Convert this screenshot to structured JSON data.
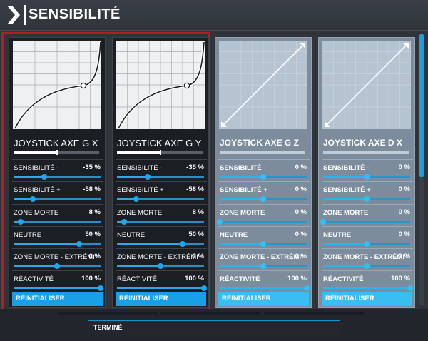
{
  "header": {
    "title": "SENSIBILITÉ"
  },
  "cards": [
    {
      "title": "JOYSTICK AXE G X",
      "top_bar_level": 0.5,
      "graph": "curve",
      "rows": [
        {
          "label": "SENSIBILITÉ -",
          "value": "-35 %",
          "level": 0.35
        },
        {
          "label": "SENSIBILITÉ +",
          "value": "-58 %",
          "level": 0.22
        },
        {
          "label": "ZONE MORTE",
          "value": "8 %",
          "level": 0.08
        },
        {
          "label": "NEUTRE",
          "value": "50 %",
          "level": 0.75
        },
        {
          "label": "ZONE MORTE - EXTRÉMI",
          "value": "0 %",
          "level": 0.5
        },
        {
          "label": "RÉACTIVITÉ",
          "value": "100 %",
          "level": 1.0
        }
      ],
      "reset_label": "RÉINITIALISER"
    },
    {
      "title": "JOYSTICK AXE G Y",
      "top_bar_level": 0.5,
      "graph": "curve",
      "rows": [
        {
          "label": "SENSIBILITÉ -",
          "value": "-35 %",
          "level": 0.35
        },
        {
          "label": "SENSIBILITÉ +",
          "value": "-58 %",
          "level": 0.22
        },
        {
          "label": "ZONE MORTE",
          "value": "8 %",
          "level": 0.08
        },
        {
          "label": "NEUTRE",
          "value": "50 %",
          "level": 0.75
        },
        {
          "label": "ZONE MORTE - EXTRÉMI",
          "value": "0 %",
          "level": 0.5
        },
        {
          "label": "RÉACTIVITÉ",
          "value": "100 %",
          "level": 1.0
        }
      ],
      "reset_label": "RÉINITIALISER"
    },
    {
      "title": "JOYSTICK AXE G Z",
      "top_bar_level": 0.0,
      "graph": "linear",
      "rows": [
        {
          "label": "SENSIBILITÉ -",
          "value": "0 %",
          "level": 0.5
        },
        {
          "label": "SENSIBILITÉ +",
          "value": "0 %",
          "level": 0.5
        },
        {
          "label": "ZONE MORTE",
          "value": "0 %",
          "level": 0.0
        },
        {
          "label": "NEUTRE",
          "value": "0 %",
          "level": 0.5
        },
        {
          "label": "ZONE MORTE - EXTRÉMI",
          "value": "0 %",
          "level": 0.5
        },
        {
          "label": "RÉACTIVITÉ",
          "value": "100 %",
          "level": 1.0
        }
      ],
      "reset_label": "RÉINITIALISER"
    },
    {
      "title": "JOYSTICK AXE D X",
      "top_bar_level": 0.0,
      "graph": "linear",
      "rows": [
        {
          "label": "SENSIBILITÉ -",
          "value": "0 %",
          "level": 0.5
        },
        {
          "label": "SENSIBILITÉ +",
          "value": "0 %",
          "level": 0.5
        },
        {
          "label": "ZONE MORTE",
          "value": "0 %",
          "level": 0.0
        },
        {
          "label": "NEUTRE",
          "value": "0 %",
          "level": 0.5
        },
        {
          "label": "ZONE MORTE - EXTRÉMI",
          "value": "0 %",
          "level": 0.5
        },
        {
          "label": "RÉACTIVITÉ",
          "value": "100 %",
          "level": 1.0
        }
      ],
      "reset_label": "RÉINITIALISER"
    }
  ],
  "footer": {
    "done_label": "TERMINÉ"
  },
  "colors": {
    "accent": "#18a0e6",
    "selection": "#b01e24",
    "panel_dark": "#1b1e23",
    "panel_light": "#7d8c9c"
  }
}
